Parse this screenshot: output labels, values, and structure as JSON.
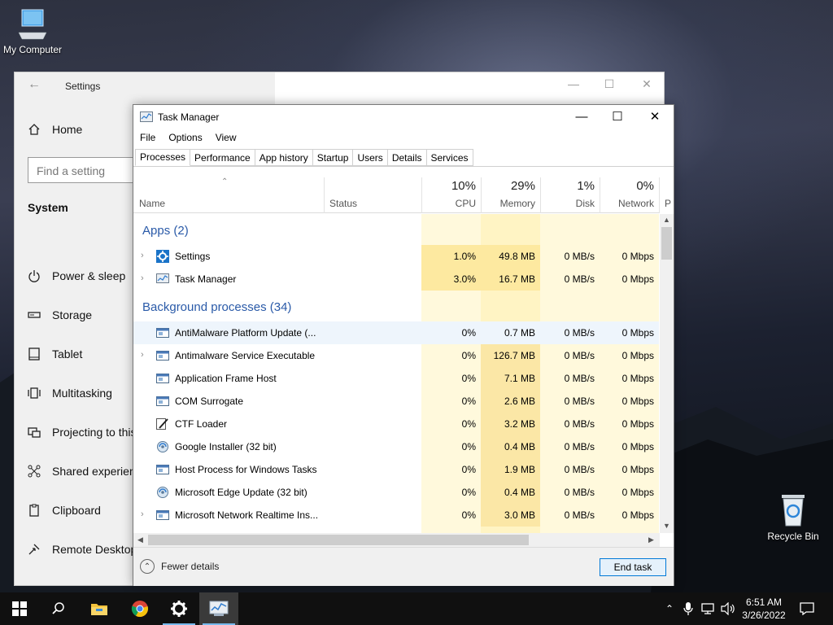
{
  "desktop": {
    "icons": [
      {
        "label": "My Computer",
        "icon": "computer-icon"
      },
      {
        "label": "Recycle Bin",
        "icon": "recycle-bin-icon"
      }
    ]
  },
  "settings": {
    "title": "Settings",
    "home": "Home",
    "search_placeholder": "Find a setting",
    "section": "System",
    "menu": [
      {
        "label": "Power & sleep",
        "icon": "power-icon"
      },
      {
        "label": "Storage",
        "icon": "storage-icon"
      },
      {
        "label": "Tablet",
        "icon": "tablet-icon"
      },
      {
        "label": "Multitasking",
        "icon": "multitasking-icon"
      },
      {
        "label": "Projecting to this PC",
        "icon": "projecting-icon"
      },
      {
        "label": "Shared experiences",
        "icon": "shared-icon"
      },
      {
        "label": "Clipboard",
        "icon": "clipboard-icon"
      },
      {
        "label": "Remote Desktop",
        "icon": "remote-desktop-icon"
      }
    ]
  },
  "taskmanager": {
    "title": "Task Manager",
    "menu": [
      "File",
      "Options",
      "View"
    ],
    "tabs": [
      "Processes",
      "Performance",
      "App history",
      "Startup",
      "Users",
      "Details",
      "Services"
    ],
    "active_tab": "Processes",
    "columns": {
      "name": "Name",
      "status": "Status",
      "cpu": {
        "pct": "10%",
        "label": "CPU"
      },
      "memory": {
        "pct": "29%",
        "label": "Memory"
      },
      "disk": {
        "pct": "1%",
        "label": "Disk"
      },
      "network": {
        "pct": "0%",
        "label": "Network"
      },
      "power": "P"
    },
    "groups": {
      "apps": "Apps (2)",
      "background": "Background processes (34)"
    },
    "apps": [
      {
        "name": "Settings",
        "cpu": "1.0%",
        "memory": "49.8 MB",
        "disk": "0 MB/s",
        "network": "0 Mbps",
        "expandable": true,
        "icon": "settings-gear-icon"
      },
      {
        "name": "Task Manager",
        "cpu": "3.0%",
        "memory": "16.7 MB",
        "disk": "0 MB/s",
        "network": "0 Mbps",
        "expandable": true,
        "icon": "task-manager-icon"
      }
    ],
    "background": [
      {
        "name": "AntiMalware Platform Update (...",
        "cpu": "0%",
        "memory": "0.7 MB",
        "disk": "0 MB/s",
        "network": "0 Mbps",
        "expandable": false,
        "icon": "window-icon"
      },
      {
        "name": "Antimalware Service Executable",
        "cpu": "0%",
        "memory": "126.7 MB",
        "disk": "0 MB/s",
        "network": "0 Mbps",
        "expandable": true,
        "icon": "window-icon"
      },
      {
        "name": "Application Frame Host",
        "cpu": "0%",
        "memory": "7.1 MB",
        "disk": "0 MB/s",
        "network": "0 Mbps",
        "expandable": false,
        "icon": "window-icon"
      },
      {
        "name": "COM Surrogate",
        "cpu": "0%",
        "memory": "2.6 MB",
        "disk": "0 MB/s",
        "network": "0 Mbps",
        "expandable": false,
        "icon": "window-icon"
      },
      {
        "name": "CTF Loader",
        "cpu": "0%",
        "memory": "3.2 MB",
        "disk": "0 MB/s",
        "network": "0 Mbps",
        "expandable": false,
        "icon": "pen-icon"
      },
      {
        "name": "Google Installer (32 bit)",
        "cpu": "0%",
        "memory": "0.4 MB",
        "disk": "0 MB/s",
        "network": "0 Mbps",
        "expandable": false,
        "icon": "installer-icon"
      },
      {
        "name": "Host Process for Windows Tasks",
        "cpu": "0%",
        "memory": "1.9 MB",
        "disk": "0 MB/s",
        "network": "0 Mbps",
        "expandable": false,
        "icon": "window-icon"
      },
      {
        "name": "Microsoft Edge Update (32 bit)",
        "cpu": "0%",
        "memory": "0.4 MB",
        "disk": "0 MB/s",
        "network": "0 Mbps",
        "expandable": false,
        "icon": "installer-icon"
      },
      {
        "name": "Microsoft Network Realtime Ins...",
        "cpu": "0%",
        "memory": "3.0 MB",
        "disk": "0 MB/s",
        "network": "0 Mbps",
        "expandable": true,
        "icon": "window-icon"
      }
    ],
    "fewer_details": "Fewer details",
    "end_task": "End task"
  },
  "taskbar": {
    "time": "6:51 AM",
    "date": "3/26/2022",
    "apps": [
      "start-icon",
      "search-icon",
      "file-explorer-icon",
      "chrome-icon",
      "settings-gear-icon",
      "task-manager-icon"
    ]
  },
  "colors": {
    "accent": "#0078d7",
    "group_text": "#2a5aa8",
    "heat_light": "#fff9dc",
    "heat_medium": "#fff1b3",
    "heat_strong": "#fde68a"
  }
}
